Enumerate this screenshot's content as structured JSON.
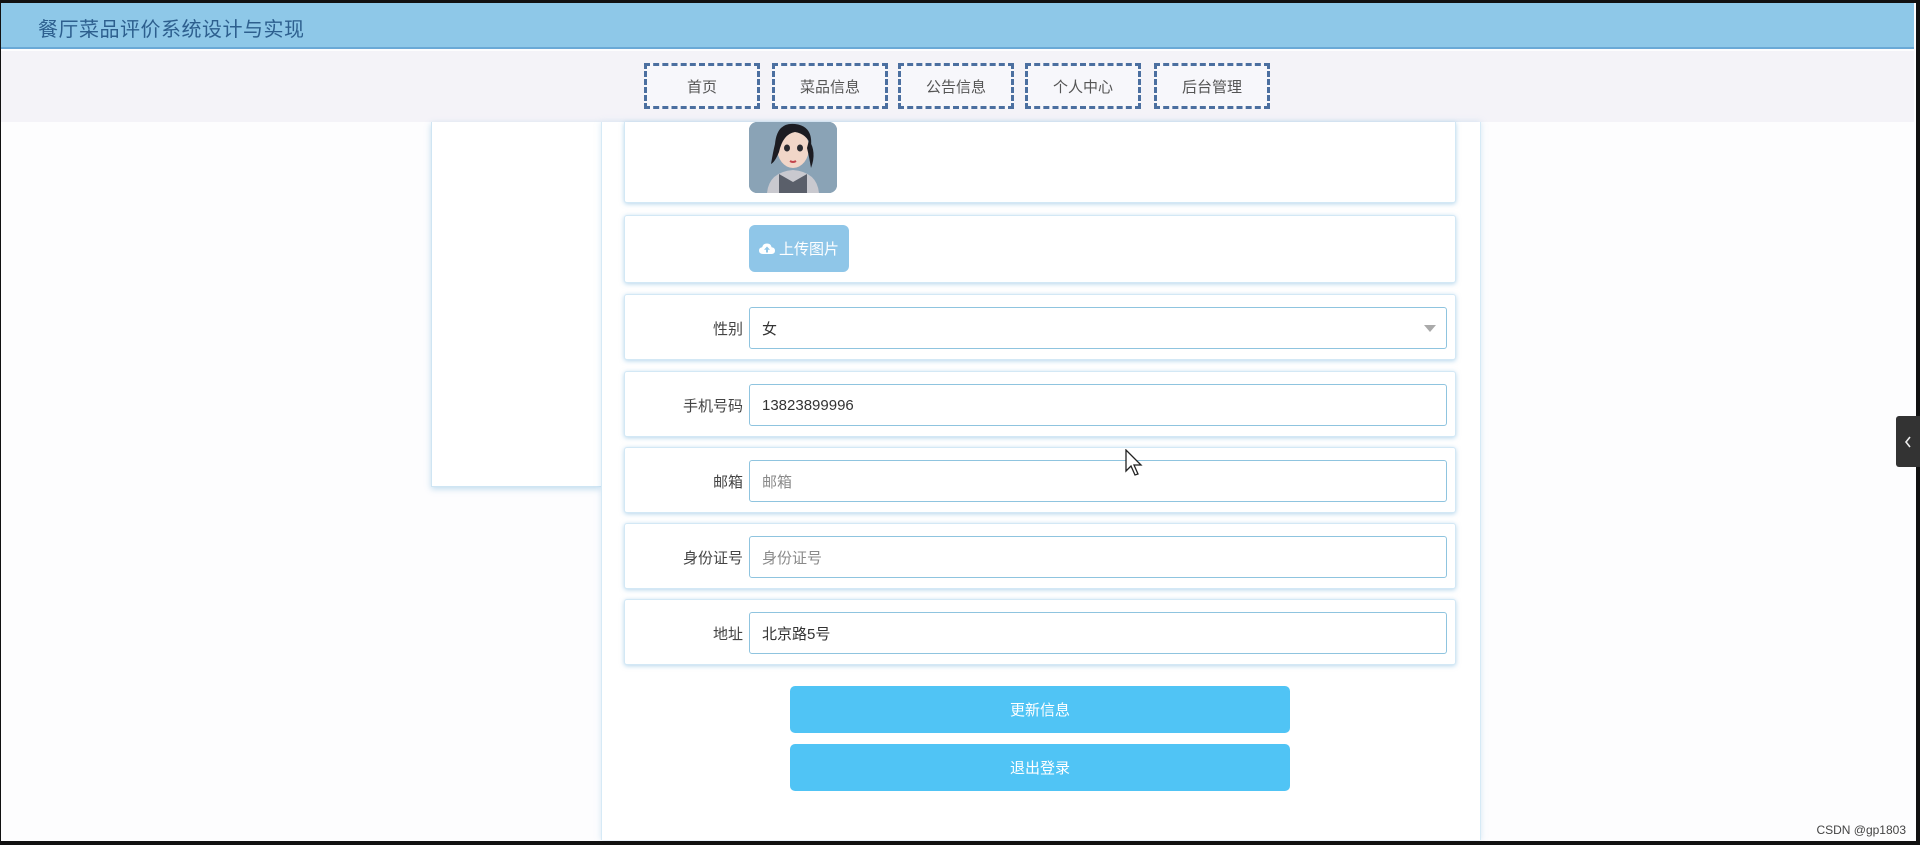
{
  "header": {
    "title": "餐厅菜品评价系统设计与实现"
  },
  "nav": {
    "items": [
      {
        "label": "首页"
      },
      {
        "label": "菜品信息"
      },
      {
        "label": "公告信息"
      },
      {
        "label": "个人中心"
      },
      {
        "label": "后台管理"
      }
    ]
  },
  "profile": {
    "upload_label": "上传图片",
    "gender": {
      "label": "性别",
      "value": "女"
    },
    "phone": {
      "label": "手机号码",
      "value": "13823899996"
    },
    "email": {
      "label": "邮箱",
      "placeholder": "邮箱"
    },
    "id_card": {
      "label": "身份证号",
      "placeholder": "身份证号"
    },
    "address": {
      "label": "地址",
      "value": "北京路5号"
    },
    "update_button": "更新信息",
    "logout_button": "退出登录"
  },
  "watermark": "CSDN @gp1803",
  "colors": {
    "header_bg": "#8ec8e8",
    "nav_border": "#4b6fa0",
    "primary_button": "#50c4f5",
    "upload_button": "#8fc6e8"
  },
  "icons": {
    "upload": "cloud-upload-icon",
    "dropdown": "chevron-down-icon",
    "side_tab": "chevron-left-icon"
  }
}
